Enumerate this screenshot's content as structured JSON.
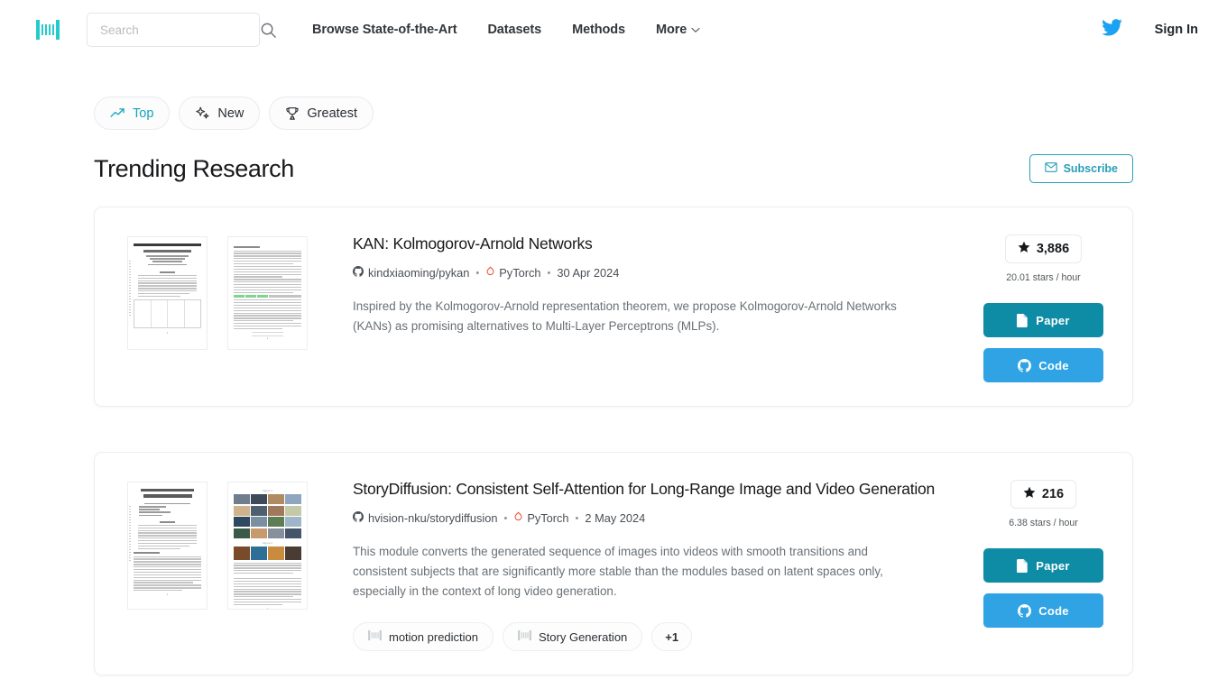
{
  "header": {
    "logo_icon": "paperswithcode-barcode-logo",
    "logo_color": "#21cbce",
    "search": {
      "value": "",
      "placeholder": "Search",
      "icon": "search-icon"
    },
    "nav": [
      {
        "label": "Browse State-of-the-Art",
        "has_chevron": false
      },
      {
        "label": "Datasets",
        "has_chevron": false
      },
      {
        "label": "Methods",
        "has_chevron": false
      },
      {
        "label": "More",
        "has_chevron": true
      }
    ],
    "twitter_icon": "twitter-bird-icon",
    "twitter_color": "#1da1f2",
    "signin_label": "Sign In"
  },
  "filters": [
    {
      "label": "Top",
      "icon": "trending-up-icon",
      "active": true
    },
    {
      "label": "New",
      "icon": "sparkles-icon",
      "active": false
    },
    {
      "label": "Greatest",
      "icon": "trophy-icon",
      "active": false
    }
  ],
  "page_title": "Trending Research",
  "subscribe": {
    "label": "Subscribe",
    "icon": "envelope-icon",
    "color": "#2a9fb5"
  },
  "accent": {
    "teal": "#13a5b8",
    "paper_button": "#0e8ca6",
    "code_button": "#2fa3e3"
  },
  "papers": [
    {
      "title": "KAN: Kolmogorov-Arnold Networks",
      "repo": "kindxiaoming/pykan",
      "repo_icon": "github-icon",
      "framework": "PyTorch",
      "framework_icon": "pytorch-icon",
      "date": "30 Apr 2024",
      "abstract": "Inspired by the Kolmogorov-Arnold representation theorem, we propose Kolmogorov-Arnold Networks (KANs) as promising alternatives to Multi-Layer Perceptrons (MLPs).",
      "stars": "3,886",
      "star_icon": "star-icon",
      "rate": "20.01 stars / hour",
      "paper_button": "Paper",
      "paper_button_icon": "document-icon",
      "code_button": "Code",
      "code_button_icon": "github-icon",
      "tags": []
    },
    {
      "title": "StoryDiffusion: Consistent Self-Attention for Long-Range Image and Video Generation",
      "repo": "hvision-nku/storydiffusion",
      "repo_icon": "github-icon",
      "framework": "PyTorch",
      "framework_icon": "pytorch-icon",
      "date": "2 May 2024",
      "abstract": "This module converts the generated sequence of images into videos with smooth transitions and consistent subjects that are significantly more stable than the modules based on latent spaces only, especially in the context of long video generation.",
      "stars": "216",
      "star_icon": "star-icon",
      "rate": "6.38 stars / hour",
      "paper_button": "Paper",
      "paper_button_icon": "document-icon",
      "code_button": "Code",
      "code_button_icon": "github-icon",
      "tags": [
        {
          "label": "motion prediction",
          "icon": "task-barcode-icon"
        },
        {
          "label": "Story Generation",
          "icon": "task-barcode-icon"
        },
        {
          "label": "+1",
          "icon": null
        }
      ]
    }
  ]
}
